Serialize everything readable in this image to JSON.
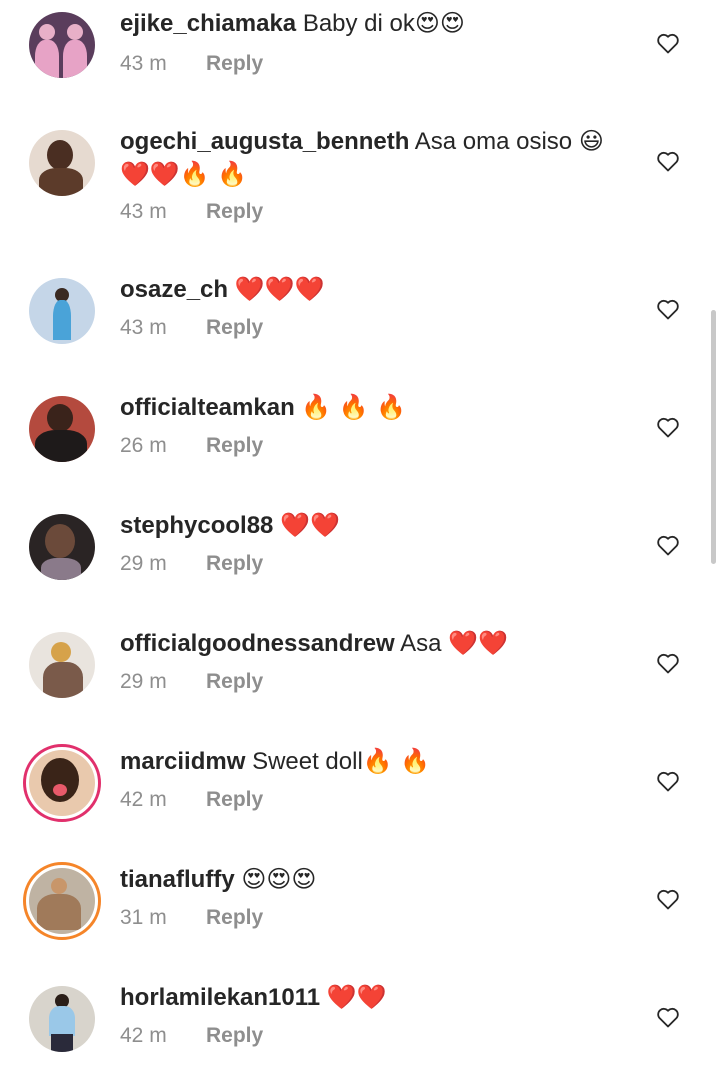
{
  "comments": [
    {
      "username": "ejike_chiamaka",
      "text": "Baby di ok",
      "emoji": "😍😍",
      "time": "43 m",
      "reply": "Reply",
      "avatar_color": "#6b4a6e"
    },
    {
      "username": "ogechi_augusta_benneth",
      "text": "Asa oma osiso",
      "emoji": "😃",
      "emoji2": "❤️❤️🔥 🔥",
      "time": "43 m",
      "reply": "Reply",
      "avatar_color": "#d9c7b8"
    },
    {
      "username": "osaze_ch",
      "text": "",
      "emoji": "❤️❤️❤️",
      "time": "43 m",
      "reply": "Reply",
      "avatar_color": "#b9cbe0"
    },
    {
      "username": "officialteamkan",
      "text": "",
      "emoji": "🔥 🔥 🔥",
      "time": "26 m",
      "reply": "Reply",
      "avatar_color": "#a3473c"
    },
    {
      "username": "stephycool88",
      "text": "",
      "emoji": "❤️❤️",
      "time": "29 m",
      "reply": "Reply",
      "avatar_color": "#3a3030"
    },
    {
      "username": "officialgoodnessandrew",
      "text": "Asa",
      "emoji": "❤️❤️",
      "time": "29 m",
      "reply": "Reply",
      "avatar_color": "#c9a15a"
    },
    {
      "username": "marciidmw",
      "text": "Sweet doll",
      "emoji": "🔥 🔥",
      "time": "42 m",
      "reply": "Reply",
      "avatar_color": "#e8c3a6"
    },
    {
      "username": "tianafluffy",
      "text": "",
      "emoji": "😍😍😍",
      "time": "31 m",
      "reply": "Reply",
      "avatar_color": "#b5a28c"
    },
    {
      "username": "horlamilekan1011",
      "text": "",
      "emoji": "❤️❤️",
      "time": "42 m",
      "reply": "Reply",
      "avatar_color": "#d8d4cc"
    }
  ],
  "colors": {
    "text": "#262626",
    "muted": "#8e8e8e",
    "story_ring": "#d6249f"
  },
  "icons": {
    "like": "heart-outline-icon"
  }
}
